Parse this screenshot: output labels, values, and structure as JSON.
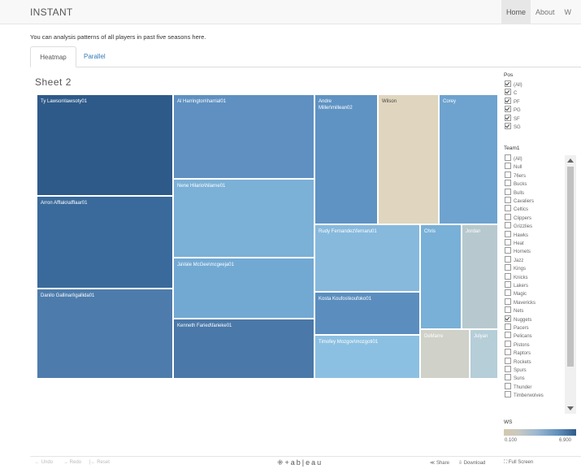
{
  "navbar": {
    "brand": "INSTANT",
    "links": [
      "Home",
      "About",
      "W"
    ]
  },
  "intro": "You can analysis patterns of all players in past five seasons here.",
  "tabs": [
    "Heatmap",
    "Parallel"
  ],
  "sheet_title": "Sheet 2",
  "treemap": [
    {
      "label": "Ty Lawson\\lawsoty01",
      "color": "#2e5a8a"
    },
    {
      "label": "Arron Afflalo\\afflaar01",
      "color": "#3a6a9b"
    },
    {
      "label": "Danilo Gallinari\\gallida01",
      "color": "#4d7cac"
    },
    {
      "label": "Al Harrington\\harrial01",
      "color": "#5f90c1"
    },
    {
      "label": "Nene Hilario\\hilarne01",
      "color": "#7bb0d7"
    },
    {
      "label": "JaVale McGee\\mcgeeja01",
      "color": "#72a9d3"
    },
    {
      "label": "Kenneth Faried\\farieke01",
      "color": "#4a78a8"
    },
    {
      "label": "Andre\nMiller\\millean02",
      "color": "#5f93c3"
    },
    {
      "label": "Wilson",
      "color": "#e0d5be"
    },
    {
      "label": "Corey",
      "color": "#6ea3cf"
    },
    {
      "label": "Rudy Fernandez\\fernaru01",
      "color": "#87b9dd"
    },
    {
      "label": "Chris",
      "color": "#78b0d7"
    },
    {
      "label": "Jordan",
      "color": "#b7c9ce"
    },
    {
      "label": "Kosta Koufos\\koufoko01",
      "color": "#5b8ebf"
    },
    {
      "label": "Timofey Mozgov\\mozgoti01",
      "color": "#8cc0e2"
    },
    {
      "label": "DeMarre",
      "color": "#d0d1c8"
    },
    {
      "label": "Julyan",
      "color": "#b5ced8"
    }
  ],
  "filters": {
    "pos": {
      "title": "Pos",
      "options": [
        {
          "label": "(All)",
          "checked": true
        },
        {
          "label": "C",
          "checked": true
        },
        {
          "label": "PF",
          "checked": true
        },
        {
          "label": "PG",
          "checked": true
        },
        {
          "label": "SF",
          "checked": true
        },
        {
          "label": "SG",
          "checked": true
        }
      ]
    },
    "team": {
      "title": "Team1",
      "options": [
        {
          "label": "(All)",
          "checked": false
        },
        {
          "label": "Null",
          "checked": false
        },
        {
          "label": "76ers",
          "checked": false
        },
        {
          "label": "Bucks",
          "checked": false
        },
        {
          "label": "Bulls",
          "checked": false
        },
        {
          "label": "Cavaliers",
          "checked": false
        },
        {
          "label": "Celtics",
          "checked": false
        },
        {
          "label": "Clippers",
          "checked": false
        },
        {
          "label": "Grizzlies",
          "checked": false
        },
        {
          "label": "Hawks",
          "checked": false
        },
        {
          "label": "Heat",
          "checked": false
        },
        {
          "label": "Hornets",
          "checked": false
        },
        {
          "label": "Jazz",
          "checked": false
        },
        {
          "label": "Kings",
          "checked": false
        },
        {
          "label": "Knicks",
          "checked": false
        },
        {
          "label": "Lakers",
          "checked": false
        },
        {
          "label": "Magic",
          "checked": false
        },
        {
          "label": "Mavericks",
          "checked": false
        },
        {
          "label": "Nets",
          "checked": false
        },
        {
          "label": "Nuggets",
          "checked": true
        },
        {
          "label": "Pacers",
          "checked": false
        },
        {
          "label": "Pelicans",
          "checked": false
        },
        {
          "label": "Pistons",
          "checked": false
        },
        {
          "label": "Raptors",
          "checked": false
        },
        {
          "label": "Rockets",
          "checked": false
        },
        {
          "label": "Spurs",
          "checked": false
        },
        {
          "label": "Suns",
          "checked": false
        },
        {
          "label": "Thunder",
          "checked": false
        },
        {
          "label": "Timberwolves",
          "checked": false
        }
      ]
    }
  },
  "legend": {
    "title": "WS",
    "min": "0.100",
    "max": "6.900"
  },
  "footer": {
    "undo": "← Undo",
    "redo": "→ Redo",
    "reset": "|← Reset",
    "logo": "⁜+ab|eau",
    "share": "≪ Share",
    "download": "⇩ Download",
    "fullscreen": "⛶ Full Screen"
  }
}
